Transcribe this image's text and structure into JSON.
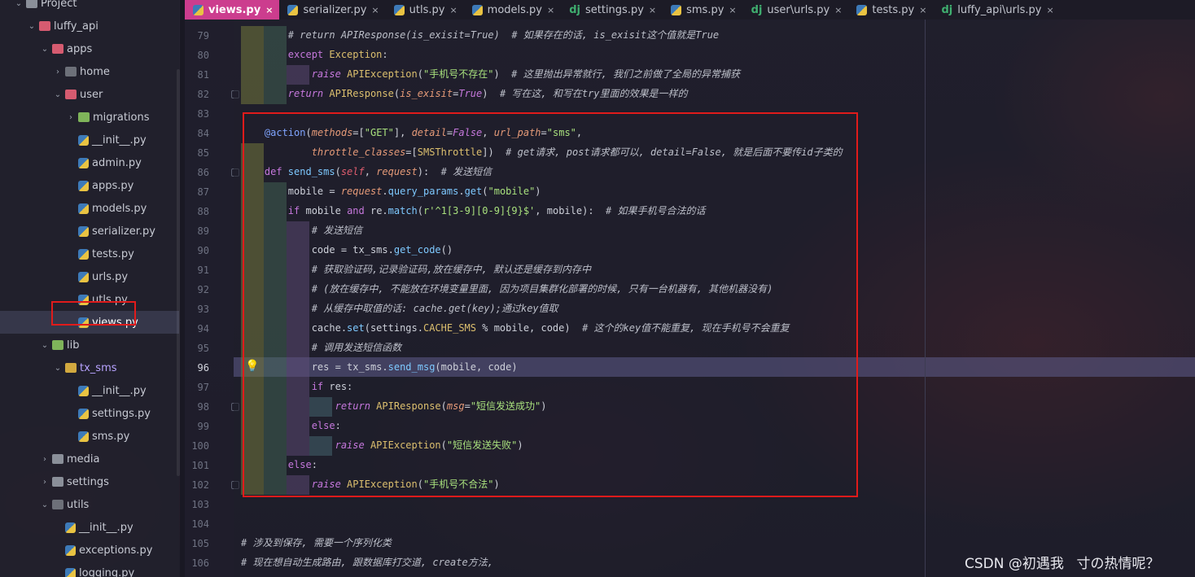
{
  "project_tree": [
    {
      "label": "Project",
      "depth": 0,
      "icon": "project-icon",
      "arrow": "down"
    },
    {
      "label": "luffy_api",
      "depth": 1,
      "icon": "folder-icon",
      "arrow": "down"
    },
    {
      "label": "apps",
      "depth": 2,
      "icon": "folder-icon",
      "arrow": "down"
    },
    {
      "label": "home",
      "depth": 3,
      "icon": "folder-icon",
      "arrow": "right"
    },
    {
      "label": "user",
      "depth": 3,
      "icon": "folder-icon",
      "arrow": "down"
    },
    {
      "label": "migrations",
      "depth": 4,
      "icon": "folder-icon",
      "arrow": "right"
    },
    {
      "label": "__init__.py",
      "depth": 4,
      "icon": "python-file-icon"
    },
    {
      "label": "admin.py",
      "depth": 4,
      "icon": "python-file-icon"
    },
    {
      "label": "apps.py",
      "depth": 4,
      "icon": "python-file-icon"
    },
    {
      "label": "models.py",
      "depth": 4,
      "icon": "python-file-icon"
    },
    {
      "label": "serializer.py",
      "depth": 4,
      "icon": "python-file-icon"
    },
    {
      "label": "tests.py",
      "depth": 4,
      "icon": "python-file-icon"
    },
    {
      "label": "urls.py",
      "depth": 4,
      "icon": "python-file-icon"
    },
    {
      "label": "utls.py",
      "depth": 4,
      "icon": "python-file-icon"
    },
    {
      "label": "views.py",
      "depth": 4,
      "icon": "python-file-icon",
      "selected": true
    },
    {
      "label": "lib",
      "depth": 2,
      "icon": "folder-icon",
      "arrow": "down"
    },
    {
      "label": "tx_sms",
      "depth": 3,
      "icon": "folder-icon",
      "arrow": "down"
    },
    {
      "label": "__init__.py",
      "depth": 4,
      "icon": "python-file-icon"
    },
    {
      "label": "settings.py",
      "depth": 4,
      "icon": "python-file-icon"
    },
    {
      "label": "sms.py",
      "depth": 4,
      "icon": "python-file-icon"
    },
    {
      "label": "media",
      "depth": 2,
      "icon": "folder-icon",
      "arrow": "right"
    },
    {
      "label": "settings",
      "depth": 2,
      "icon": "folder-icon",
      "arrow": "right"
    },
    {
      "label": "utils",
      "depth": 2,
      "icon": "folder-icon",
      "arrow": "down"
    },
    {
      "label": "__init__.py",
      "depth": 3,
      "icon": "python-file-icon"
    },
    {
      "label": "exceptions.py",
      "depth": 3,
      "icon": "python-file-icon"
    },
    {
      "label": "logging.py",
      "depth": 3,
      "icon": "python-file-icon"
    }
  ],
  "tabs": [
    {
      "label": "views.py",
      "icon": "python",
      "active": true
    },
    {
      "label": "serializer.py",
      "icon": "python"
    },
    {
      "label": "utls.py",
      "icon": "python"
    },
    {
      "label": "models.py",
      "icon": "python"
    },
    {
      "label": "settings.py",
      "icon": "django"
    },
    {
      "label": "sms.py",
      "icon": "python"
    },
    {
      "label": "user\\urls.py",
      "icon": "django"
    },
    {
      "label": "tests.py",
      "icon": "python"
    },
    {
      "label": "luffy_api\\urls.py",
      "icon": "django"
    }
  ],
  "tab_close_glyph": "×",
  "django_glyph": "dj",
  "bulb_glyph": "💡",
  "line_numbers": [
    "79",
    "80",
    "81",
    "82",
    "83",
    "84",
    "85",
    "86",
    "87",
    "88",
    "89",
    "90",
    "91",
    "92",
    "93",
    "94",
    "95",
    "96",
    "97",
    "98",
    "99",
    "100",
    "101",
    "102",
    "103",
    "104",
    "105",
    "106"
  ],
  "current_line": "96",
  "code_lines": [
    [
      [
        "cm",
        "        # return APIResponse(is_exisit=True)  # 如果存在的话, is_exisit这个值就是True"
      ]
    ],
    [
      [
        "t",
        "        "
      ],
      [
        "kw",
        "except "
      ],
      [
        "cls",
        "Exception"
      ],
      [
        "t",
        ":"
      ]
    ],
    [
      [
        "t",
        "            "
      ],
      [
        "kwi",
        "raise "
      ],
      [
        "cls",
        "APIException"
      ],
      [
        "t",
        "("
      ],
      [
        "str",
        "\"手机号不存在\""
      ],
      [
        "t",
        ")  "
      ],
      [
        "cm",
        "# 这里抛出异常就行, 我们之前做了全局的异常捕获"
      ]
    ],
    [
      [
        "t",
        "        "
      ],
      [
        "kwi",
        "return "
      ],
      [
        "cls",
        "APIResponse"
      ],
      [
        "t",
        "("
      ],
      [
        "par",
        "is_exisit"
      ],
      [
        "t",
        "="
      ],
      [
        "kwi",
        "True"
      ],
      [
        "t",
        ")  "
      ],
      [
        "cm",
        "# 写在这, 和写在try里面的效果是一样的"
      ]
    ],
    [],
    [
      [
        "deco",
        "    @action"
      ],
      [
        "t",
        "("
      ],
      [
        "par",
        "methods"
      ],
      [
        "t",
        "=["
      ],
      [
        "str",
        "\"GET\""
      ],
      [
        "t",
        "], "
      ],
      [
        "par",
        "detail"
      ],
      [
        "t",
        "="
      ],
      [
        "kwi",
        "False"
      ],
      [
        "t",
        ", "
      ],
      [
        "par",
        "url_path"
      ],
      [
        "t",
        "="
      ],
      [
        "str",
        "\"sms\""
      ],
      [
        "t",
        ","
      ]
    ],
    [
      [
        "t",
        "            "
      ],
      [
        "par",
        "throttle_classes"
      ],
      [
        "t",
        "=["
      ],
      [
        "cls",
        "SMSThrottle"
      ],
      [
        "t",
        "])  "
      ],
      [
        "cm",
        "# get请求, post请求都可以, detail=False, 就是后面不要传id子类的"
      ]
    ],
    [
      [
        "kw",
        "    def "
      ],
      [
        "fn",
        "send_sms"
      ],
      [
        "t",
        "("
      ],
      [
        "self",
        "self"
      ],
      [
        "t",
        ", "
      ],
      [
        "par",
        "request"
      ],
      [
        "t",
        "):  "
      ],
      [
        "cm",
        "# 发送短信"
      ]
    ],
    [
      [
        "t",
        "        mobile = "
      ],
      [
        "par",
        "request"
      ],
      [
        "t",
        "."
      ],
      [
        "fn",
        "query_params"
      ],
      [
        "t",
        "."
      ],
      [
        "fn",
        "get"
      ],
      [
        "t",
        "("
      ],
      [
        "str",
        "\"mobile\""
      ],
      [
        "t",
        ")"
      ]
    ],
    [
      [
        "kw",
        "        if "
      ],
      [
        "t",
        "mobile "
      ],
      [
        "kw",
        "and "
      ],
      [
        "t",
        "re."
      ],
      [
        "fn",
        "match"
      ],
      [
        "t",
        "("
      ],
      [
        "str",
        "r'^1[3-9][0-9]{9}$'"
      ],
      [
        "t",
        ", mobile):  "
      ],
      [
        "cm",
        "# 如果手机号合法的话"
      ]
    ],
    [
      [
        "cm",
        "            # 发送短信"
      ]
    ],
    [
      [
        "t",
        "            code = tx_sms."
      ],
      [
        "fn",
        "get_code"
      ],
      [
        "t",
        "()"
      ]
    ],
    [
      [
        "cm",
        "            # 获取验证码,记录验证码,放在缓存中, 默认还是缓存到内存中"
      ]
    ],
    [
      [
        "cm",
        "            # (放在缓存中, 不能放在环境变量里面, 因为项目集群化部署的时候, 只有一台机器有, 其他机器没有)"
      ]
    ],
    [
      [
        "cm",
        "            # 从缓存中取值的话: cache.get(key);通过key值取"
      ]
    ],
    [
      [
        "t",
        "            cache."
      ],
      [
        "fn",
        "set"
      ],
      [
        "t",
        "(settings."
      ],
      [
        "cls",
        "CACHE_SMS"
      ],
      [
        "t",
        " % mobile, code)  "
      ],
      [
        "cm",
        "# 这个的key值不能重复, 现在手机号不会重复"
      ]
    ],
    [
      [
        "cm",
        "            # 调用发送短信函数"
      ]
    ],
    [
      [
        "t",
        "            res = tx_sms."
      ],
      [
        "fn",
        "send_msg"
      ],
      [
        "t",
        "(mobile, code)"
      ]
    ],
    [
      [
        "kw",
        "            if "
      ],
      [
        "t",
        "res:"
      ]
    ],
    [
      [
        "kwi",
        "                return "
      ],
      [
        "cls",
        "APIResponse"
      ],
      [
        "t",
        "("
      ],
      [
        "par",
        "msg"
      ],
      [
        "t",
        "="
      ],
      [
        "str",
        "\"短信发送成功\""
      ],
      [
        "t",
        ")"
      ]
    ],
    [
      [
        "kw",
        "            else"
      ],
      [
        "t",
        ":"
      ]
    ],
    [
      [
        "kwi",
        "                raise "
      ],
      [
        "cls",
        "APIException"
      ],
      [
        "t",
        "("
      ],
      [
        "str",
        "\"短信发送失败\""
      ],
      [
        "t",
        ")"
      ]
    ],
    [
      [
        "kw",
        "        else"
      ],
      [
        "t",
        ":"
      ]
    ],
    [
      [
        "kwi",
        "            raise "
      ],
      [
        "cls",
        "APIException"
      ],
      [
        "t",
        "("
      ],
      [
        "str",
        "\"手机号不合法\""
      ],
      [
        "t",
        ")"
      ]
    ],
    [],
    [],
    [
      [
        "cm",
        "# 涉及到保存, 需要一个序列化类"
      ]
    ],
    [
      [
        "cm",
        "# 现在想自动生成路由, 跟数据库打交道, create方法,"
      ]
    ]
  ],
  "watermark": "CSDN @初遇我ㅤ寸の热情呢？",
  "colors": {
    "active_tab": "#cc3d8e",
    "highlight_box": "#e01b1b",
    "current_line": "#5f5c8c"
  }
}
